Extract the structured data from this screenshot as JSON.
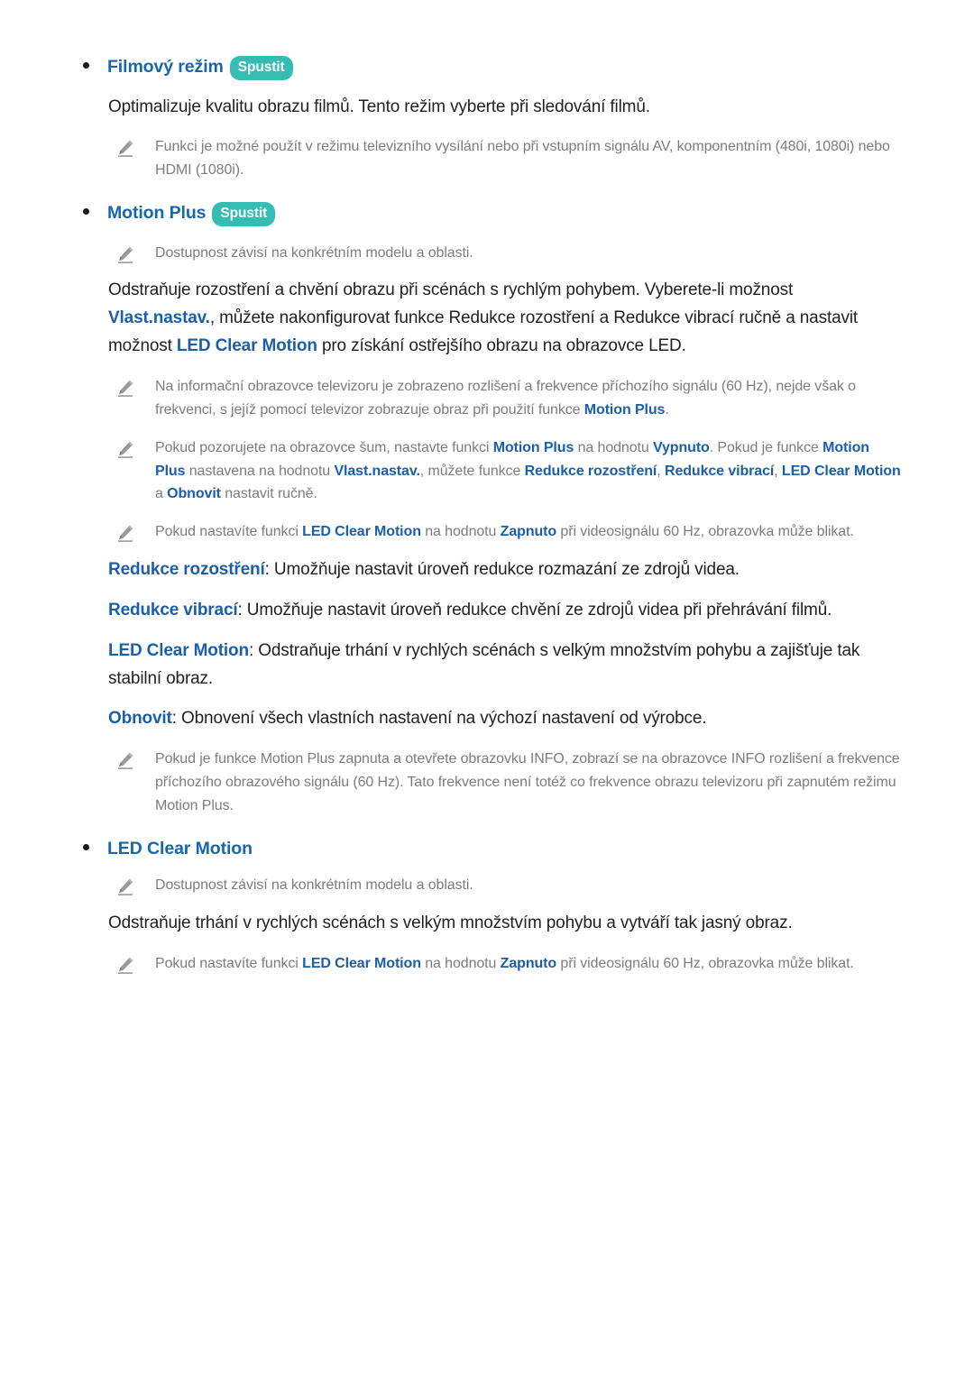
{
  "document": {
    "language": "cs",
    "background_color": "#ffffff",
    "text_color": "#231f20",
    "heading_color": "#1767ad",
    "term_color": "#1b5faa",
    "note_color": "#7d7d7d",
    "badge_color": "#35bdb4",
    "badge_text_color": "#ffffff"
  },
  "icons": {
    "note": "pencil-icon",
    "bullet": "bullet-dot-icon"
  },
  "sections": {
    "film_mode": {
      "heading": "Filmový režim",
      "badge": "Spustit",
      "description": "Optimalizuje kvalitu obrazu filmů. Tento režim vyberte při sledování filmů.",
      "note_1": {
        "part_1": "Funkci je možné použít v režimu televizního vysílání nebo při vstupním signálu AV, komponentním (480i, 1080i) nebo HDMI (1080i)."
      }
    },
    "motion_plus": {
      "heading": "Motion Plus",
      "badge": "Spustit",
      "availability_note": "Dostupnost závisí na konkrétním modelu a oblasti.",
      "description": {
        "part_1": "Odstraňuje rozostření a chvění obrazu při scénách s rychlým pohybem. Vyberete-li možnost ",
        "term_1": "Vlast.nastav.",
        "part_2": ", můžete nakonfigurovat funkce Redukce rozostření a Redukce vibrací ručně a nastavit možnost ",
        "term_2": "LED Clear Motion",
        "part_3": " pro získání ostřejšího obrazu na obrazovce LED."
      },
      "note_1": {
        "part_1": "Na informační obrazovce televizoru je zobrazeno rozlišení a frekvence příchozího signálu (60 Hz), nejde však o frekvenci, s jejíž pomocí televizor zobrazuje obraz při použití funkce ",
        "term_1": "Motion Plus",
        "part_2": "."
      },
      "note_2": {
        "part_1": "Pokud pozorujete na obrazovce šum, nastavte funkci ",
        "term_1": "Motion Plus",
        "part_2": " na hodnotu ",
        "term_2": "Vypnuto",
        "part_3": ". Pokud je funkce ",
        "term_3": "Motion Plus",
        "part_4": " nastavena na hodnotu ",
        "term_4": "Vlast.nastav.",
        "part_5": ", můžete funkce ",
        "term_5": "Redukce rozostření",
        "part_6": ", ",
        "term_6": "Redukce vibrací",
        "part_7": ", ",
        "term_7": "LED Clear Motion",
        "part_8": " a ",
        "term_8": "Obnovit",
        "part_9": " nastavit ručně."
      },
      "note_3": {
        "part_1": "Pokud nastavíte funkci ",
        "term_1": "LED Clear Motion",
        "part_2": " na hodnotu ",
        "term_2": "Zapnuto",
        "part_3": " při videosignálu 60 Hz, obrazovka může blikat."
      },
      "definitions": {
        "blur_reduction": {
          "term": "Redukce rozostření",
          "text": ": Umožňuje nastavit úroveň redukce rozmazání ze zdrojů videa."
        },
        "judder_reduction": {
          "term": "Redukce vibrací",
          "text": ": Umožňuje nastavit úroveň redukce chvění ze zdrojů videa při přehrávání filmů."
        },
        "led_clear_motion": {
          "term": "LED Clear Motion",
          "text": ": Odstraňuje trhání v rychlých scénách s velkým množstvím pohybu a zajišťuje tak stabilní obraz."
        },
        "reset": {
          "term": "Obnovit",
          "text": ": Obnovení všech vlastních nastavení na výchozí nastavení od výrobce."
        }
      },
      "note_4": {
        "part_1": "Pokud je funkce Motion Plus zapnuta a otevřete obrazovku INFO, zobrazí se na obrazovce INFO rozlišení a frekvence příchozího obrazového signálu (60 Hz). Tato frekvence není totéž co frekvence obrazu televizoru při zapnutém režimu Motion Plus."
      }
    },
    "led_clear_motion": {
      "heading": "LED Clear Motion",
      "availability_note": "Dostupnost závisí na konkrétním modelu a oblasti.",
      "description": "Odstraňuje trhání v rychlých scénách s velkým množstvím pohybu a vytváří tak jasný obraz.",
      "note_1": {
        "part_1": "Pokud nastavíte funkci ",
        "term_1": "LED Clear Motion",
        "part_2": " na hodnotu ",
        "term_2": "Zapnuto",
        "part_3": " při videosignálu 60 Hz, obrazovka může blikat."
      }
    }
  }
}
